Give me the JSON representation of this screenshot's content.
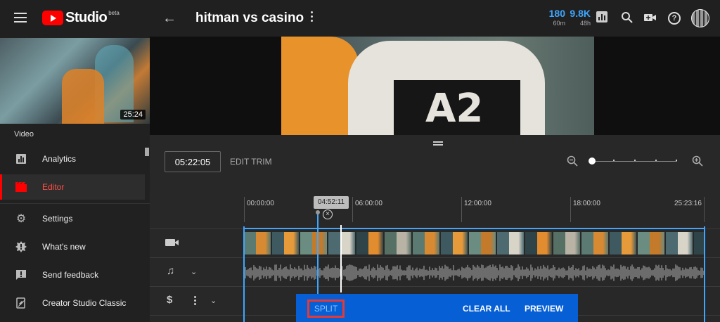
{
  "app": {
    "logo_text": "Studio",
    "logo_badge": "beta"
  },
  "header": {
    "video_title": "hitman vs casino",
    "stats": [
      {
        "value": "180",
        "period": "60m"
      },
      {
        "value": "9.8K",
        "period": "48h"
      }
    ],
    "icons": [
      "menu-icon",
      "back-arrow-icon",
      "more-vert-icon",
      "analytics-bars-icon",
      "search-icon",
      "create-video-icon",
      "help-icon",
      "avatar"
    ]
  },
  "sidebar": {
    "thumbnail_duration": "25:24",
    "section_label": "Video",
    "items": [
      {
        "label": "Analytics",
        "icon": "analytics-icon",
        "active": false
      },
      {
        "label": "Editor",
        "icon": "editor-icon",
        "active": true
      },
      {
        "label": "Settings",
        "icon": "gear-icon",
        "active": false
      },
      {
        "label": "What's new",
        "icon": "whats-new-icon",
        "active": false
      },
      {
        "label": "Send feedback",
        "icon": "feedback-icon",
        "active": false
      },
      {
        "label": "Creator Studio Classic",
        "icon": "classic-icon",
        "active": false
      }
    ]
  },
  "editor": {
    "current_time": "05:22:05",
    "edit_trim_label": "EDIT TRIM",
    "zoom_level": 0,
    "playhead_time": "04:52:11",
    "ruler_labels": [
      "00:00:00",
      "06:00:00",
      "12:00:00",
      "18:00:00",
      "25:23:16"
    ],
    "split_toolbar": {
      "split_label": "SPLIT",
      "clear_all_label": "CLEAR ALL",
      "preview_label": "PREVIEW"
    }
  },
  "colors": {
    "accent_blue": "#3ea6ff",
    "brand_red": "#ff0000",
    "toolbar_blue": "#065fd4",
    "highlight_red": "#e53935"
  }
}
